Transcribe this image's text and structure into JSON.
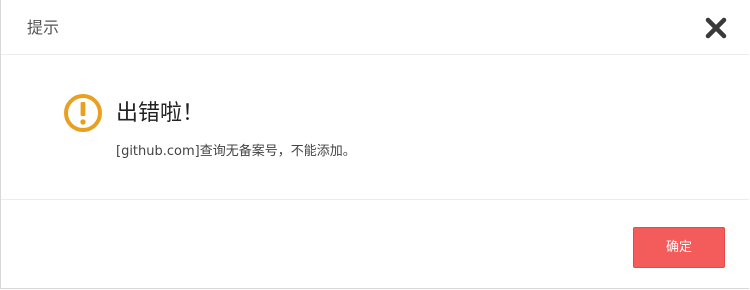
{
  "dialog": {
    "title": "提示",
    "close_icon": "close-icon",
    "message_icon": "warning-icon",
    "message_title": "出错啦！",
    "message_detail": "[github.com]查询无备案号，不能添加。",
    "confirm_label": "确定",
    "colors": {
      "warning": "#e9a020",
      "confirm_button": "#f45b5b",
      "close_icon": "#3a3a3a"
    }
  }
}
